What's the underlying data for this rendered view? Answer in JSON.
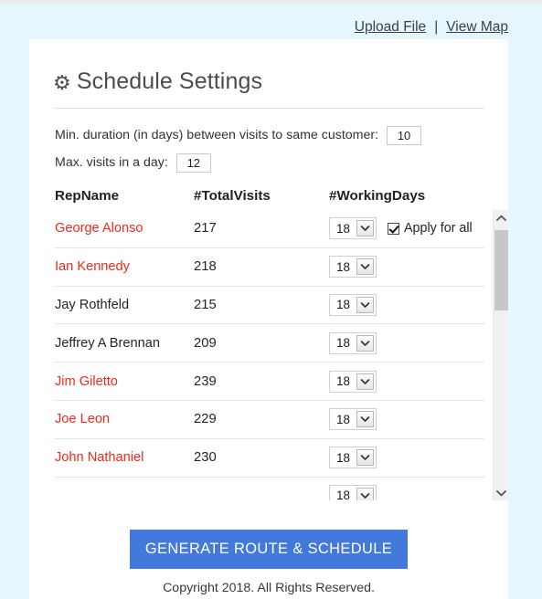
{
  "topbar": {
    "upload_link": "Upload File",
    "separator": "|",
    "viewmap_link": "View Map"
  },
  "card": {
    "title": "Schedule Settings",
    "gear_icon": "gear-icon"
  },
  "settings": {
    "min_duration_label": "Min. duration (in days) between visits to same customer:",
    "min_duration_value": "10",
    "max_visits_label": "Max. visits in a day:",
    "max_visits_value": "12"
  },
  "table": {
    "headers": {
      "name": "RepName",
      "total_visits": "#TotalVisits",
      "working_days": "#WorkingDays"
    },
    "apply_for_all_label": "Apply for all",
    "apply_for_all_checked": true,
    "select_arrow_icon": "chevron-down-icon",
    "rows": [
      {
        "name": "George Alonso",
        "visits": "217",
        "days": "18",
        "flagged": true
      },
      {
        "name": "Ian Kennedy",
        "visits": "218",
        "days": "18",
        "flagged": true
      },
      {
        "name": "Jay Rothfeld",
        "visits": "215",
        "days": "18",
        "flagged": false
      },
      {
        "name": "Jeffrey A Brennan",
        "visits": "209",
        "days": "18",
        "flagged": false
      },
      {
        "name": "Jim Giletto",
        "visits": "239",
        "days": "18",
        "flagged": true
      },
      {
        "name": "Joe Leon",
        "visits": "229",
        "days": "18",
        "flagged": true
      },
      {
        "name": "John Nathaniel",
        "visits": "230",
        "days": "18",
        "flagged": true
      },
      {
        "name": "",
        "visits": "",
        "days": "18",
        "flagged": true
      }
    ]
  },
  "scrollbar": {
    "up_icon": "chevron-up-icon",
    "down_icon": "chevron-down-icon"
  },
  "footer": {
    "generate_button": "GENERATE ROUTE & SCHEDULE",
    "copyright": "Copyright 2018. All Rights Reserved."
  },
  "colors": {
    "page_background": "#e5f7fc",
    "accent_blue": "#4379da",
    "flag_red": "#f5271a",
    "card_background": "#ffffff"
  }
}
